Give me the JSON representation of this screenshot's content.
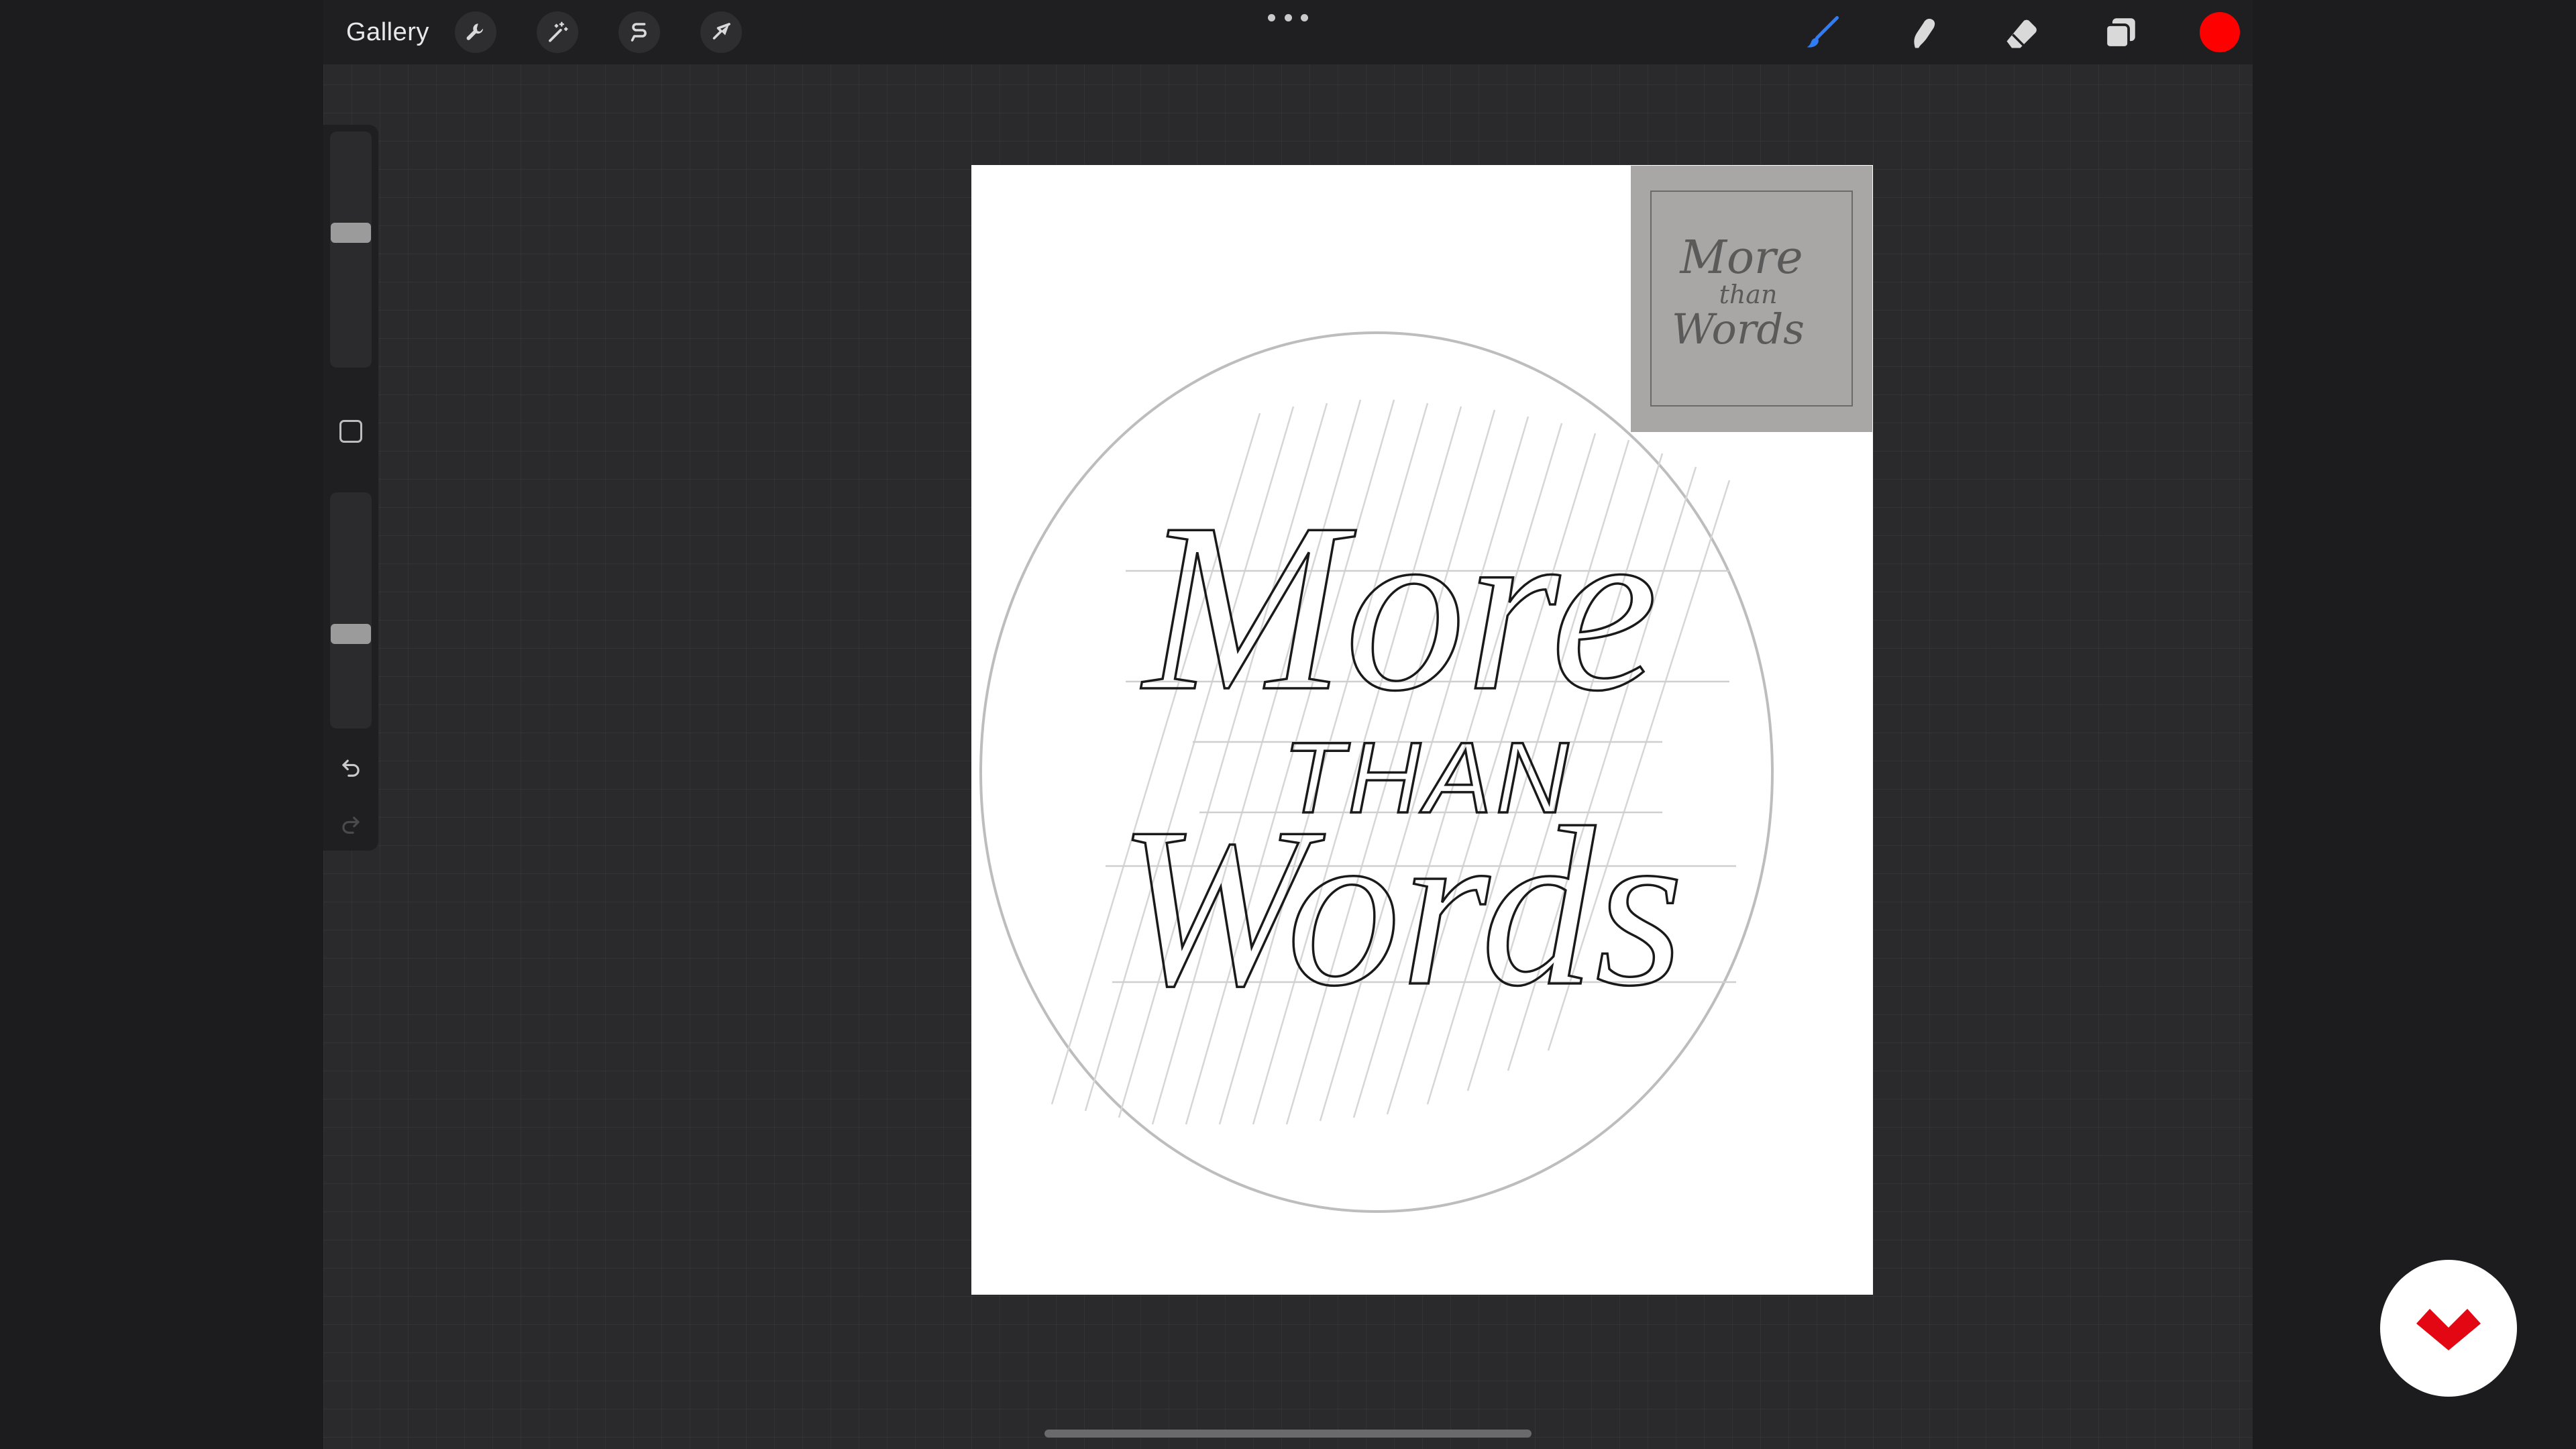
{
  "toolbar": {
    "gallery_label": "Gallery",
    "left_tools": [
      {
        "icon": "wrench-icon",
        "name": "actions"
      },
      {
        "icon": "magic-wand-icon",
        "name": "adjustments"
      },
      {
        "icon": "selection-s-icon",
        "name": "selection"
      },
      {
        "icon": "arrow-cursor-icon",
        "name": "transform"
      }
    ],
    "right_tools": [
      {
        "icon": "brush-icon",
        "name": "paint",
        "active": true
      },
      {
        "icon": "smudge-icon",
        "name": "smudge"
      },
      {
        "icon": "eraser-icon",
        "name": "erase"
      },
      {
        "icon": "layers-icon",
        "name": "layers"
      }
    ],
    "active_color": "#ff0000",
    "accent_color": "#2f7cf6"
  },
  "sidebar": {
    "brush_size_level": 0.42,
    "opacity_level": 0.58,
    "modify_icon": "square-icon",
    "undo_icon": "undo-icon",
    "redo_icon": "redo-icon"
  },
  "canvas": {
    "sketch_lines": [
      "More",
      "THAN",
      "Words"
    ]
  },
  "reference": {
    "sketch_lines": [
      "More",
      "than",
      "Words"
    ]
  },
  "brand": {
    "icon": "domestika-logo-icon",
    "color": "#e30613"
  }
}
